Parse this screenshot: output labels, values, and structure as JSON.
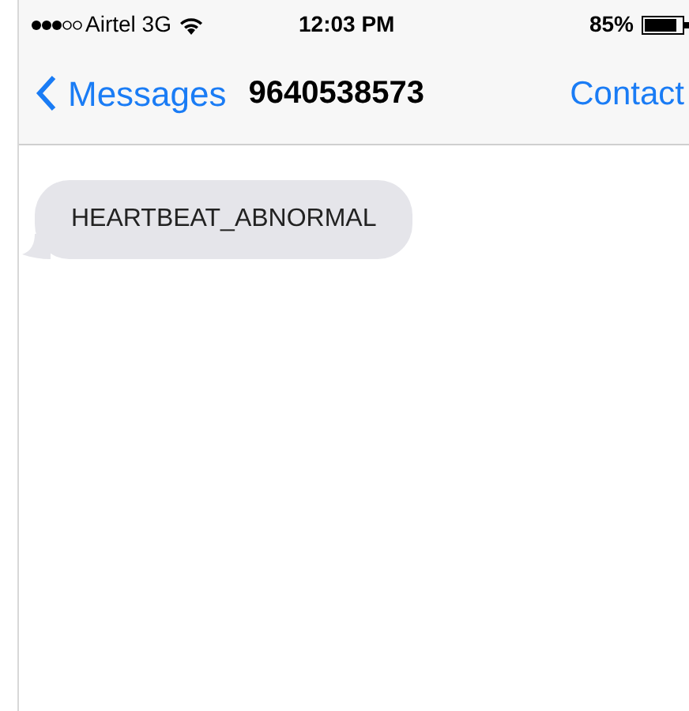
{
  "status_bar": {
    "carrier": "Airtel 3G",
    "time": "12:03 PM",
    "battery": "85%"
  },
  "nav_bar": {
    "back_label": "Messages",
    "title": "9640538573",
    "action": "Contact"
  },
  "messages": [
    {
      "kind": "received",
      "text": "HEARTBEAT_ABNORMAL"
    }
  ]
}
